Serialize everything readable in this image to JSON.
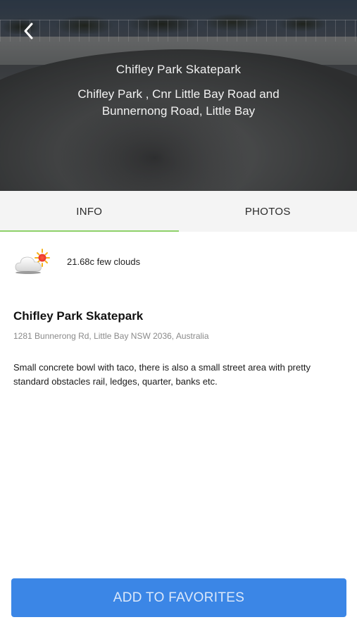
{
  "hero": {
    "title": "Chifley Park Skatepark",
    "address": "Chifley Park , Cnr Little Bay Road and Bunnernong Road, Little Bay",
    "back_icon": "chevron-left-icon"
  },
  "tabs": [
    {
      "label": "INFO",
      "active": true
    },
    {
      "label": "PHOTOS",
      "active": false
    }
  ],
  "colors": {
    "tab_indicator": "#8ed16a",
    "button": "#3b86e6",
    "tab_bar": "#f4f4f4"
  },
  "weather": {
    "icon": "cloud-sun-icon",
    "text": "21.68c few clouds"
  },
  "park": {
    "name": "Chifley Park Skatepark",
    "address": "1281 Bunnerong Rd, Little Bay NSW 2036, Australia",
    "description": "Small concrete bowl with taco, there is also a small street area with pretty standard obstacles rail, ledges, quarter, banks etc."
  },
  "actions": {
    "favorite_label": "ADD TO FAVORITES"
  }
}
